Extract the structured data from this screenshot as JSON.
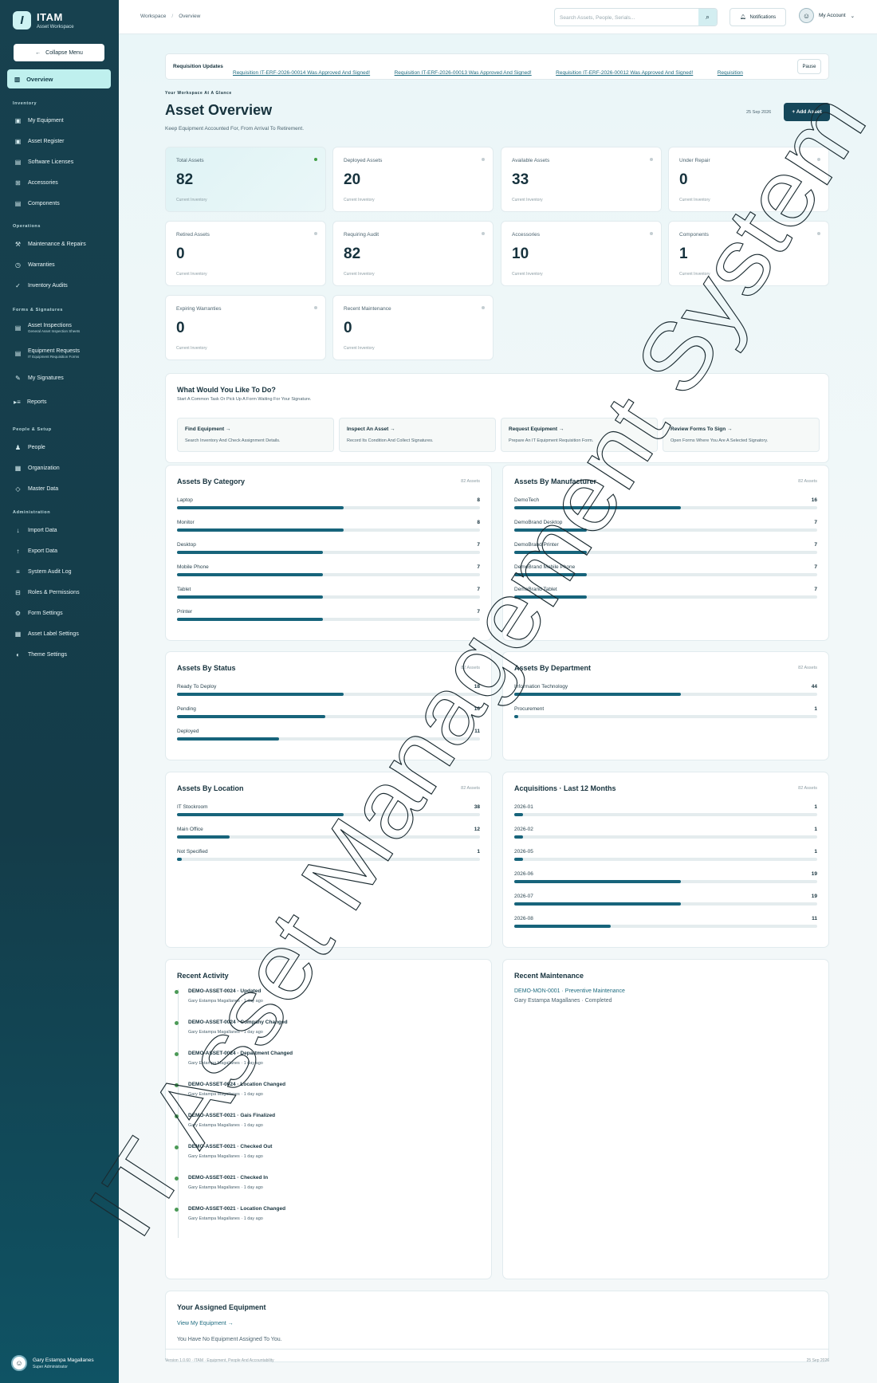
{
  "brand": {
    "name": "ITAM",
    "subtitle": "Asset Workspace",
    "logo_letter": "I"
  },
  "sidebar": {
    "collapse_label": "Collapse Menu",
    "overview_label": "Overview",
    "sections": {
      "inventory": "Inventory",
      "operations": "Operations",
      "forms": "Forms & Signatures",
      "people": "People & Setup",
      "administration": "Administration"
    },
    "items": {
      "my_equipment": "My Equipment",
      "asset_register": "Asset Register",
      "software_licenses": "Software Licenses",
      "accessories": "Accessories",
      "components": "Components",
      "maintenance": "Maintenance & Repairs",
      "warranties": "Warranties",
      "inventory_audits": "Inventory Audits",
      "asset_inspections": "Asset Inspections",
      "asset_inspections_sub": "General Asset Inspection Sheets",
      "equipment_requests": "Equipment Requests",
      "equipment_requests_sub": "IT Equipment Requisition Forms",
      "my_signatures": "My Signatures",
      "reports": "Reports",
      "people": "People",
      "organization": "Organization",
      "master_data": "Master Data",
      "import_data": "Import Data",
      "export_data": "Export Data",
      "system_audit_log": "System Audit Log",
      "roles_permissions": "Roles & Permissions",
      "form_settings": "Form Settings",
      "asset_label_settings": "Asset Label Settings",
      "theme_settings": "Theme Settings"
    },
    "user": {
      "name": "Gary Estampa Magallanes",
      "role": "Super Administrator"
    }
  },
  "topbar": {
    "breadcrumb": [
      "Workspace",
      "Overview"
    ],
    "search_placeholder": "Search Assets, People, Serials...",
    "notifications_label": "Notifications",
    "account_label": "My Account"
  },
  "ticker": {
    "label": "Requisition Updates",
    "links": [
      "Requisition IT-ERF-2026-00014 Was Approved And Signed!",
      "Requisition IT-ERF-2026-00013 Was Approved And Signed!",
      "Requisition IT-ERF-2026-00012 Was Approved And Signed!",
      "Requisition"
    ],
    "pause_label": "Pause"
  },
  "header": {
    "eyebrow": "Your Workspace At A Glance",
    "title": "Asset Overview",
    "subtitle": "Keep Equipment Accounted For, From Arrival To Retirement.",
    "date": "25 Sep 2026",
    "add_label": "+ Add Asset"
  },
  "stats": [
    {
      "label": "Total Assets",
      "value": "82",
      "note": "Current Inventory"
    },
    {
      "label": "Deployed Assets",
      "value": "20",
      "note": "Current Inventory"
    },
    {
      "label": "Available Assets",
      "value": "33",
      "note": "Current Inventory"
    },
    {
      "label": "Under Repair",
      "value": "0",
      "note": "Current Inventory"
    },
    {
      "label": "Retired Assets",
      "value": "0",
      "note": "Current Inventory"
    },
    {
      "label": "Requiring Audit",
      "value": "82",
      "note": "Current Inventory"
    },
    {
      "label": "Accessories",
      "value": "10",
      "note": "Current Inventory"
    },
    {
      "label": "Components",
      "value": "1",
      "note": "Current Inventory"
    },
    {
      "label": "Expiring Warranties",
      "value": "0",
      "note": "Current Inventory"
    },
    {
      "label": "Recent Maintenance",
      "value": "0",
      "note": "Current Inventory"
    }
  ],
  "quick_actions": {
    "title": "What Would You Like To Do?",
    "subtitle": "Start A Common Task Or Pick Up A Form Waiting For Your Signature.",
    "cards": [
      {
        "title": "Find Equipment →",
        "desc": "Search Inventory And Check Assignment Details."
      },
      {
        "title": "Inspect An Asset →",
        "desc": "Record Its Condition And Collect Signatures."
      },
      {
        "title": "Request Equipment →",
        "desc": "Prepare An IT Equipment Requisition Form."
      },
      {
        "title": "Review Forms To Sign →",
        "desc": "Open Forms Where You Are A Selected Signatory."
      }
    ]
  },
  "breakdowns": {
    "category": {
      "title": "Assets By Category",
      "count": "82 Assets",
      "max": 8,
      "rows": [
        {
          "label": "Laptop",
          "value": 8
        },
        {
          "label": "Monitor",
          "value": 8
        },
        {
          "label": "Desktop",
          "value": 7
        },
        {
          "label": "Mobile Phone",
          "value": 7
        },
        {
          "label": "Tablet",
          "value": 7
        },
        {
          "label": "Printer",
          "value": 7
        }
      ]
    },
    "manufacturer": {
      "title": "Assets By Manufacturer",
      "count": "82 Assets",
      "max": 16,
      "rows": [
        {
          "label": "DemoTech",
          "value": 16
        },
        {
          "label": "DemoBrand Desktop",
          "value": 7
        },
        {
          "label": "DemoBrand Printer",
          "value": 7
        },
        {
          "label": "DemoBrand Mobile Phone",
          "value": 7
        },
        {
          "label": "DemoBrand Tablet",
          "value": 7
        }
      ]
    },
    "status": {
      "title": "Assets By Status",
      "count": "82 Assets",
      "max": 18,
      "rows": [
        {
          "label": "Ready To Deploy",
          "value": 18
        },
        {
          "label": "Pending",
          "value": 16
        },
        {
          "label": "Deployed",
          "value": 11
        }
      ]
    },
    "department": {
      "title": "Assets By Department",
      "count": "82 Assets",
      "max": 44,
      "rows": [
        {
          "label": "Information Technology",
          "value": 44
        },
        {
          "label": "Procurement",
          "value": 1
        }
      ]
    },
    "location": {
      "title": "Assets By Location",
      "count": "82 Assets",
      "max": 38,
      "rows": [
        {
          "label": "IT Stockroom",
          "value": 38
        },
        {
          "label": "Main Office",
          "value": 12
        },
        {
          "label": "Not Specified",
          "value": 1
        }
      ]
    },
    "acquisitions": {
      "title": "Acquisitions · Last 12 Months",
      "count": "82 Assets",
      "max": 19,
      "rows": [
        {
          "label": "2026-01",
          "value": 1
        },
        {
          "label": "2026-02",
          "value": 1
        },
        {
          "label": "2026-05",
          "value": 1
        },
        {
          "label": "2026-06",
          "value": 19
        },
        {
          "label": "2026-07",
          "value": 19
        },
        {
          "label": "2026-08",
          "value": 11
        }
      ]
    }
  },
  "recent_activity": {
    "title": "Recent Activity",
    "items": [
      {
        "title": "DEMO-ASSET-0024 · Updated",
        "meta": "Gary Estampa Magallanes · 1 day ago"
      },
      {
        "title": "DEMO-ASSET-0024 · Company Changed",
        "meta": "Gary Estampa Magallanes · 1 day ago"
      },
      {
        "title": "DEMO-ASSET-0024 · Department Changed",
        "meta": "Gary Estampa Magallanes · 1 day ago"
      },
      {
        "title": "DEMO-ASSET-0024 · Location Changed",
        "meta": "Gary Estampa Magallanes · 1 day ago"
      },
      {
        "title": "DEMO-ASSET-0021 · Gais Finalized",
        "meta": "Gary Estampa Magallanes · 1 day ago"
      },
      {
        "title": "DEMO-ASSET-0021 · Checked Out",
        "meta": "Gary Estampa Magallanes · 1 day ago"
      },
      {
        "title": "DEMO-ASSET-0021 · Checked In",
        "meta": "Gary Estampa Magallanes · 1 day ago"
      },
      {
        "title": "DEMO-ASSET-0021 · Location Changed",
        "meta": "Gary Estampa Magallanes · 1 day ago"
      }
    ]
  },
  "recent_maintenance": {
    "title": "Recent Maintenance",
    "link": "DEMO-MON-0001 · Preventive Maintenance",
    "meta": "Gary Estampa Magallanes · Completed"
  },
  "assigned": {
    "title": "Your Assigned Equipment",
    "link": "View My Equipment →",
    "empty": "You Have No Equipment Assigned To You."
  },
  "footer": {
    "left": "Version 1.0.60 · ITAM · Equipment, People And Accountability",
    "right": "25 Sep 2026"
  },
  "watermark": {
    "text": "IT Asset Management System"
  },
  "colors": {
    "sidebar": "#17414f",
    "accent": "#17647b",
    "active_nav": "#bff0ee",
    "primary_button": "#15475a",
    "status_dot": "#43a047"
  }
}
